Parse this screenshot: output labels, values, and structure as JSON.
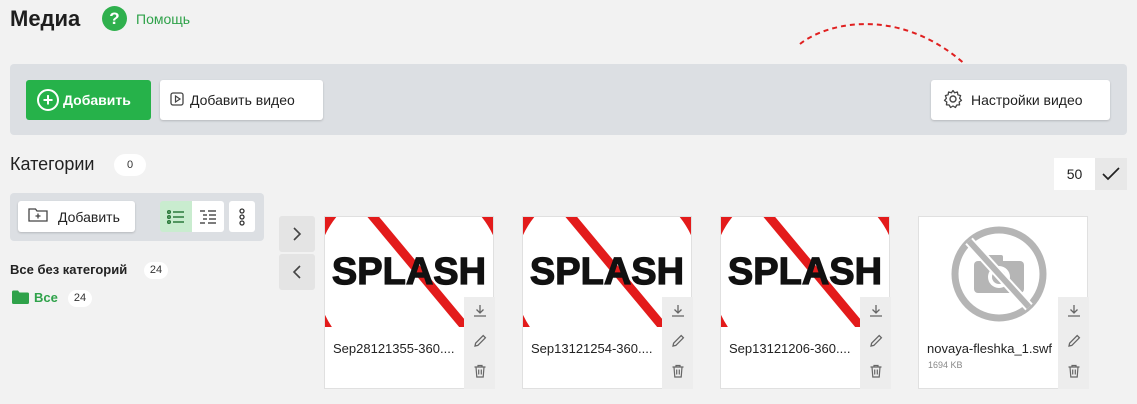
{
  "header": {
    "title": "Медиа",
    "help_label": "Помощь"
  },
  "toolbar": {
    "add_label": "Добавить",
    "add_video_label": "Добавить видео",
    "video_settings_label": "Настройки видео"
  },
  "categories": {
    "title": "Категории",
    "count": "0",
    "add_label": "Добавить",
    "uncategorized_label": "Все без категорий",
    "uncategorized_count": "24",
    "all_label": "Все",
    "all_count": "24"
  },
  "pagination": {
    "per_page": "50"
  },
  "files": [
    {
      "name": "Sep28121355-360....",
      "size": "",
      "thumb": "splash"
    },
    {
      "name": "Sep13121254-360....",
      "size": "",
      "thumb": "splash"
    },
    {
      "name": "Sep13121206-360....",
      "size": "",
      "thumb": "splash"
    },
    {
      "name": "novaya-fleshka_1.swf",
      "size": "1694 KB",
      "thumb": "no-camera"
    }
  ],
  "thumb_text": "SPLASH",
  "colors": {
    "accent": "#26b24a",
    "link": "#2fa24a",
    "annotation": "#e02020"
  }
}
